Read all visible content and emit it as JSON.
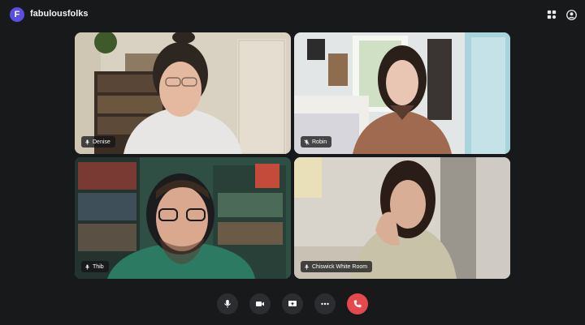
{
  "window": {
    "avatar_initial": "F",
    "room_name": "fabulousfolks",
    "avatar_color": "#5b4fe0"
  },
  "top_right": {
    "icons": [
      "participants-icon",
      "profile-icon"
    ]
  },
  "participants": [
    {
      "name": "Denise",
      "mic": "on",
      "speaking": false
    },
    {
      "name": "Robin",
      "mic": "muted",
      "speaking": false
    },
    {
      "name": "Thib",
      "mic": "on",
      "speaking": true
    },
    {
      "name": "Chiswick White Room",
      "mic": "on",
      "speaking": false
    }
  ],
  "controls": {
    "buttons": [
      "microphone-icon",
      "camera-icon",
      "screen-share-icon",
      "more-options-icon",
      "leave-call-icon"
    ],
    "leave_color": "#e5484d",
    "active_speaker_color": "#3ccf8e"
  }
}
